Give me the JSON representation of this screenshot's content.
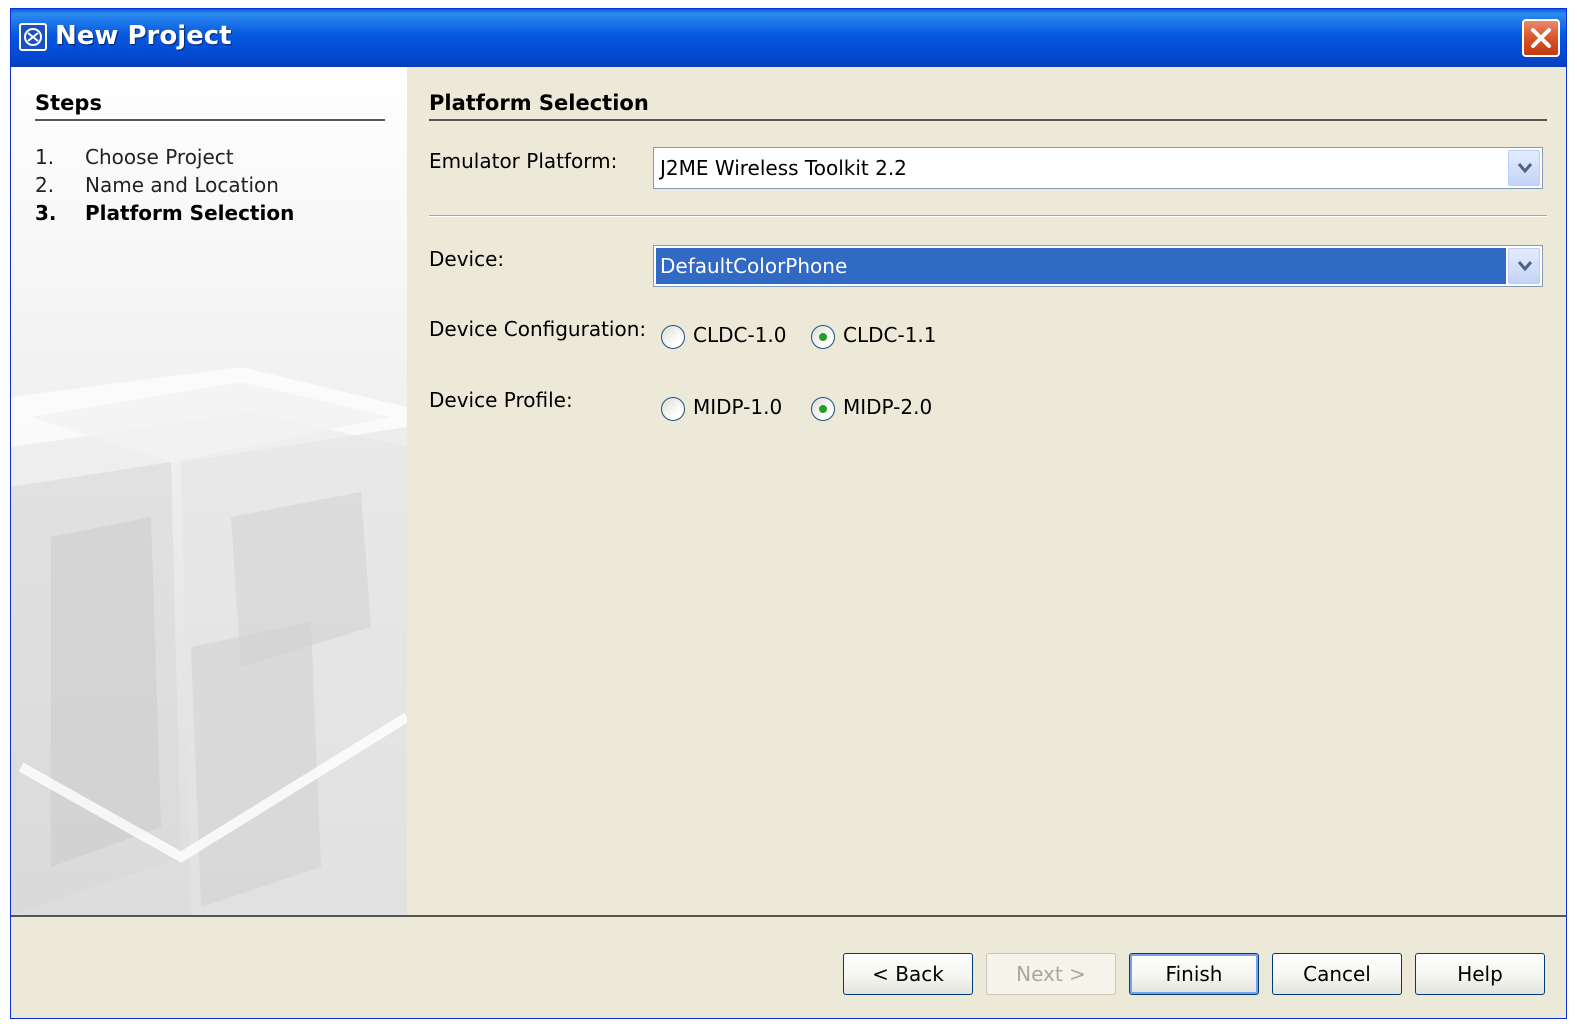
{
  "window": {
    "title": "New Project"
  },
  "steps": {
    "title": "Steps",
    "items": [
      {
        "num": "1.",
        "label": "Choose Project"
      },
      {
        "num": "2.",
        "label": "Name and Location"
      },
      {
        "num": "3.",
        "label": "Platform Selection"
      }
    ],
    "current_index": 2
  },
  "content": {
    "section_title": "Platform Selection",
    "emulator_platform": {
      "label": "Emulator Platform:",
      "value": "J2ME Wireless Toolkit 2.2"
    },
    "device": {
      "label": "Device:",
      "value": "DefaultColorPhone"
    },
    "device_configuration": {
      "label": "Device Configuration:",
      "options": [
        "CLDC-1.0",
        "CLDC-1.1"
      ],
      "selected": "CLDC-1.1"
    },
    "device_profile": {
      "label": "Device Profile:",
      "options": [
        "MIDP-1.0",
        "MIDP-2.0"
      ],
      "selected": "MIDP-2.0"
    }
  },
  "buttons": {
    "back": "< Back",
    "next": "Next >",
    "finish": "Finish",
    "cancel": "Cancel",
    "help": "Help"
  },
  "colors": {
    "titlebar": "#0758e0",
    "selection": "#316ac5",
    "radio_dot": "#21a121",
    "dialog_bg": "#ece9d8"
  }
}
